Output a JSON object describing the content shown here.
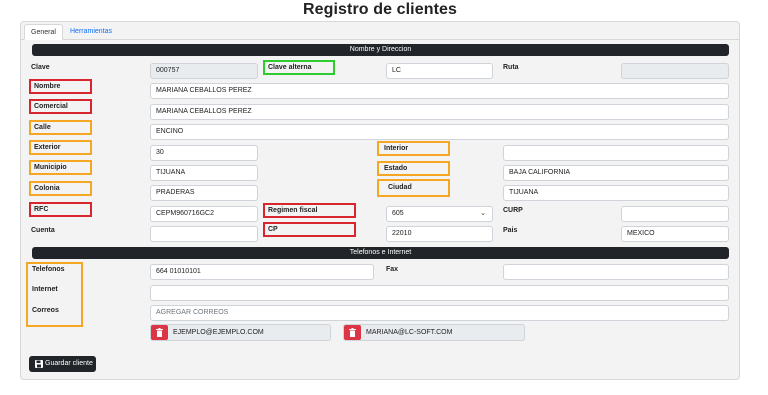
{
  "page": {
    "title": "Registro de clientes"
  },
  "tabs": [
    {
      "label": "General"
    },
    {
      "label": "Herramientas"
    }
  ],
  "sections": {
    "name_address": "Nombre y Direccion",
    "phones_internet": "Telefonos e Internet"
  },
  "fields": {
    "clave": {
      "label": "Clave",
      "value": "000757"
    },
    "clave_alterna": {
      "label": "Clave alterna",
      "value": "LC"
    },
    "ruta": {
      "label": "Ruta",
      "value": ""
    },
    "nombre": {
      "label": "Nombre",
      "value": "MARIANA CEBALLOS PEREZ"
    },
    "comercial": {
      "label": "Comercial",
      "value": "MARIANA CEBALLOS PEREZ"
    },
    "calle": {
      "label": "Calle",
      "value": "ENCINO"
    },
    "exterior": {
      "label": "Exterior",
      "value": "30"
    },
    "interior": {
      "label": "Interior",
      "value": ""
    },
    "municipio": {
      "label": "Municipio",
      "value": "TIJUANA"
    },
    "estado": {
      "label": "Estado",
      "value": "BAJA CALIFORNIA"
    },
    "colonia": {
      "label": "Colonia",
      "value": "PRADERAS"
    },
    "ciudad": {
      "label": "Ciudad",
      "value": "TIJUANA"
    },
    "rfc": {
      "label": "RFC",
      "value": "CEPM960716GC2"
    },
    "regimen_fiscal": {
      "label": "Regimen fiscal",
      "value": "605"
    },
    "curp": {
      "label": "CURP",
      "value": ""
    },
    "cuenta": {
      "label": "Cuenta",
      "value": ""
    },
    "cp": {
      "label": "CP",
      "value": "22010"
    },
    "pais": {
      "label": "Pais",
      "value": "MEXICO"
    },
    "telefonos": {
      "label": "Telefonos",
      "value": "664 01010101"
    },
    "fax": {
      "label": "Fax",
      "value": ""
    },
    "internet": {
      "label": "Internet",
      "value": ""
    },
    "correos": {
      "label": "Correos",
      "placeholder": "AGREGAR CORREOS"
    }
  },
  "emails": [
    "EJEMPLO@EJEMPLO.COM",
    "MARIANA@LC-SOFT.COM"
  ],
  "buttons": {
    "save": "Guardar cliente"
  },
  "colors": {
    "red_box": "#d9262e",
    "orange_box": "#f5a623",
    "green_box": "#2ecc2e",
    "dark_bar": "#212529",
    "trash": "#dc3545",
    "link": "#0d6efd"
  },
  "icons": {
    "trash": "trash-icon",
    "save": "floppy-disk-icon",
    "select": "chevron-down-icon"
  }
}
